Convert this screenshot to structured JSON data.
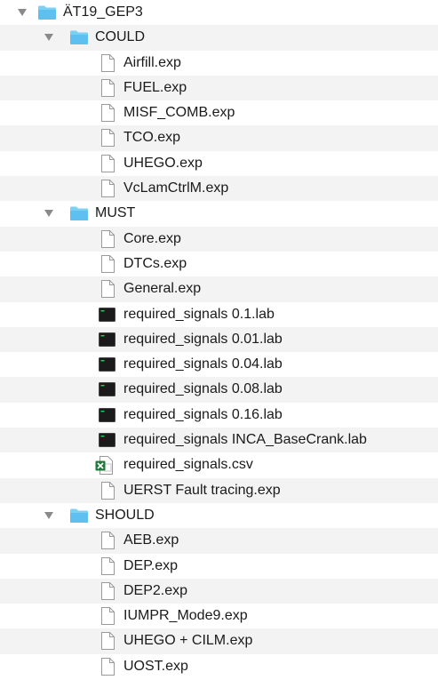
{
  "tree": {
    "root": {
      "name": "ÄT19_GEP3",
      "folders": [
        {
          "name": "COULD",
          "files": [
            {
              "name": "Airfill.exp",
              "kind": "document"
            },
            {
              "name": "FUEL.exp",
              "kind": "document"
            },
            {
              "name": "MISF_COMB.exp",
              "kind": "document"
            },
            {
              "name": "TCO.exp",
              "kind": "document"
            },
            {
              "name": "UHEGO.exp",
              "kind": "document"
            },
            {
              "name": "VcLamCtrlM.exp",
              "kind": "document"
            }
          ]
        },
        {
          "name": "MUST",
          "files": [
            {
              "name": "Core.exp",
              "kind": "document"
            },
            {
              "name": "DTCs.exp",
              "kind": "document"
            },
            {
              "name": "General.exp",
              "kind": "document"
            },
            {
              "name": "required_signals 0.1.lab",
              "kind": "terminal"
            },
            {
              "name": "required_signals 0.01.lab",
              "kind": "terminal"
            },
            {
              "name": "required_signals 0.04.lab",
              "kind": "terminal"
            },
            {
              "name": "required_signals 0.08.lab",
              "kind": "terminal"
            },
            {
              "name": "required_signals 0.16.lab",
              "kind": "terminal"
            },
            {
              "name": "required_signals INCA_BaseCrank.lab",
              "kind": "terminal"
            },
            {
              "name": "required_signals.csv",
              "kind": "spreadsheet"
            },
            {
              "name": "UERST Fault tracing.exp",
              "kind": "document"
            }
          ]
        },
        {
          "name": "SHOULD",
          "files": [
            {
              "name": "AEB.exp",
              "kind": "document"
            },
            {
              "name": "DEP.exp",
              "kind": "document"
            },
            {
              "name": "DEP2.exp",
              "kind": "document"
            },
            {
              "name": "IUMPR_Mode9.exp",
              "kind": "document"
            },
            {
              "name": "UHEGO + CILM.exp",
              "kind": "document"
            },
            {
              "name": "UOST.exp",
              "kind": "document"
            }
          ]
        }
      ]
    }
  },
  "colors": {
    "folder_body": "#5ec0f0",
    "folder_tab": "#7ccff5",
    "stripe": "#f3f3f3",
    "disclosure": "#8a8a8a",
    "spreadsheet_green": "#1f7a3a"
  },
  "icons": {
    "disclosure": "disclosure-triangle-icon",
    "folder": "folder-icon",
    "document": "document-icon",
    "terminal": "terminal-file-icon",
    "spreadsheet": "spreadsheet-file-icon"
  }
}
